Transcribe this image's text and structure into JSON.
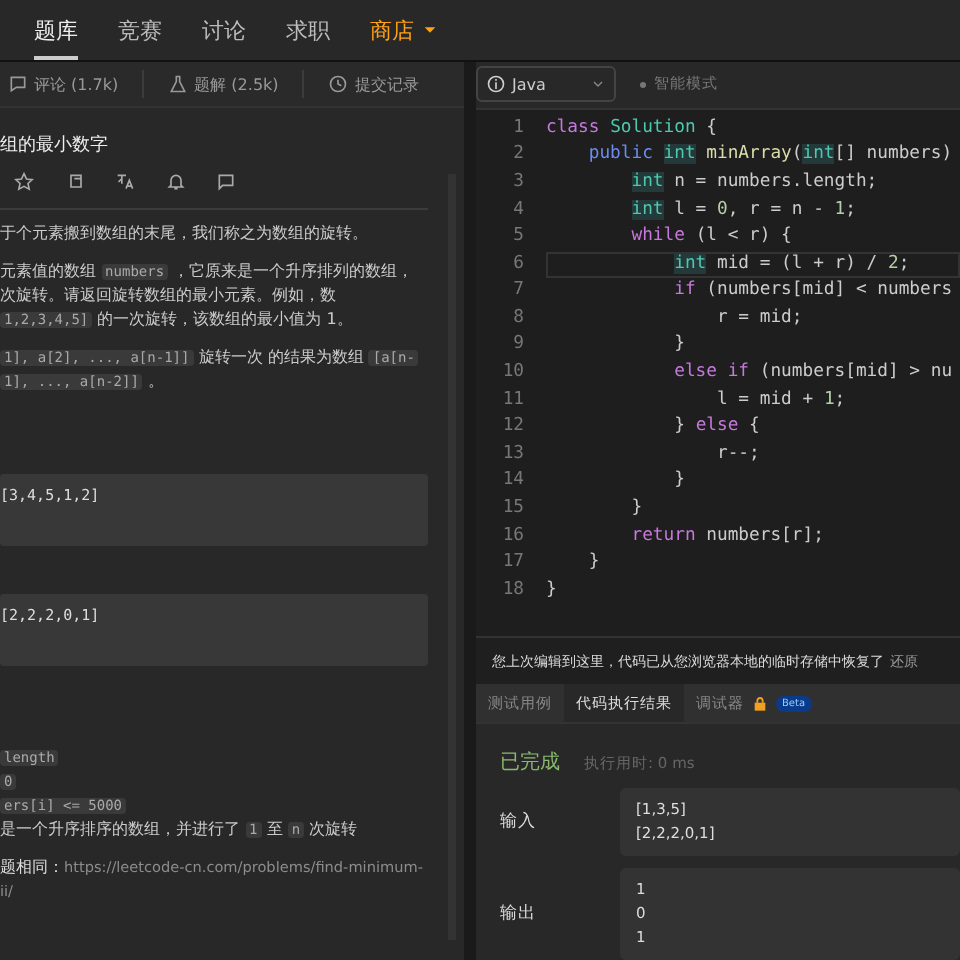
{
  "nav": [
    {
      "label": "题库",
      "selected": true,
      "kind": "plain"
    },
    {
      "label": "竞赛",
      "selected": false,
      "kind": "plain"
    },
    {
      "label": "讨论",
      "selected": false,
      "kind": "plain"
    },
    {
      "label": "求职",
      "selected": false,
      "kind": "plain"
    },
    {
      "label": "商店",
      "selected": false,
      "kind": "store"
    }
  ],
  "left_tabs": [
    {
      "label": "评论 (1.7k)"
    },
    {
      "label": "题解 (2.5k)"
    },
    {
      "label": "提交记录"
    }
  ],
  "problem": {
    "title": "组的最小数字",
    "paragraphs": [
      {
        "kind": "text",
        "lines": [
          [
            {
              "kind": "text",
              "text": "于个元素搬到数组的末尾，我们称之为数组的旋转。"
            }
          ]
        ]
      },
      {
        "kind": "text",
        "lines": [
          [
            {
              "kind": "text",
              "text": "元素值的数组 "
            },
            {
              "kind": "code",
              "text": "numbers"
            },
            {
              "kind": "text",
              "text": " ，它原来是一个升序排列的数组，"
            }
          ],
          [
            {
              "kind": "text",
              "text": "次旋转。请返回旋转数组的最小元素。例如，数"
            }
          ],
          [
            {
              "kind": "code",
              "text": "1,2,3,4,5]"
            },
            {
              "kind": "text",
              "text": " 的一次旋转，该数组的最小值为 1。"
            }
          ]
        ]
      },
      {
        "kind": "text",
        "lines": [
          [
            {
              "kind": "code",
              "text": "1], a[2], ..., a[n-1]]"
            },
            {
              "kind": "text",
              "text": " 旋转一次 的结果为数组 "
            },
            {
              "kind": "code",
              "text": "[a[n-"
            }
          ],
          [
            {
              "kind": "code",
              "text": "1], ..., a[n-2]]"
            },
            {
              "kind": "text",
              "text": " 。"
            }
          ]
        ]
      },
      {
        "kind": "example",
        "lines": [
          "[3,4,5,1,2]"
        ]
      },
      {
        "kind": "example",
        "lines": [
          "[2,2,2,0,1]"
        ]
      },
      {
        "kind": "text",
        "lines": [
          [
            {
              "kind": "code",
              "text": "length"
            }
          ],
          [
            {
              "kind": "code",
              "text": "0"
            }
          ],
          [
            {
              "kind": "code",
              "text": "ers[i] <= 5000"
            }
          ],
          [
            {
              "kind": "text",
              "text": "是一个升序排序的数组，并进行了 "
            },
            {
              "kind": "code",
              "text": "1"
            },
            {
              "kind": "text",
              "text": " 至 "
            },
            {
              "kind": "code",
              "text": "n"
            },
            {
              "kind": "text",
              "text": " 次旋转"
            }
          ]
        ]
      },
      {
        "kind": "link",
        "label": "题相同：",
        "lines": [
          "https://leetcode-cn.com/problems/find-minimum-",
          "ii/"
        ]
      }
    ]
  },
  "editor": {
    "language": "Java",
    "mode": "智能模式",
    "lines": [
      {
        "number": "1",
        "active": false,
        "tokens": [
          {
            "kind": "kw",
            "text": "class "
          },
          {
            "kind": "cls",
            "text": "Solution"
          },
          {
            "kind": "plain",
            "text": " {"
          }
        ]
      },
      {
        "number": "2",
        "active": false,
        "tokens": [
          {
            "kind": "kw2",
            "text": "    public "
          },
          {
            "kind": "type",
            "text": "int"
          },
          {
            "kind": "fn",
            "text": " minArray"
          },
          {
            "kind": "plain",
            "text": "("
          },
          {
            "kind": "type",
            "text": "int"
          },
          {
            "kind": "plain",
            "text": "[] numbers)"
          }
        ]
      },
      {
        "number": "3",
        "active": false,
        "tokens": [
          {
            "kind": "type",
            "text": "        int"
          },
          {
            "kind": "plain",
            "text": " n = numbers.length;"
          }
        ]
      },
      {
        "number": "4",
        "active": false,
        "tokens": [
          {
            "kind": "type",
            "text": "        int"
          },
          {
            "kind": "plain",
            "text": " l = "
          },
          {
            "kind": "num",
            "text": "0"
          },
          {
            "kind": "plain",
            "text": ", r = n - "
          },
          {
            "kind": "num",
            "text": "1"
          },
          {
            "kind": "plain",
            "text": ";"
          }
        ]
      },
      {
        "number": "5",
        "active": false,
        "tokens": [
          {
            "kind": "kw",
            "text": "        while"
          },
          {
            "kind": "plain",
            "text": " (l < r) {"
          }
        ]
      },
      {
        "number": "6",
        "active": true,
        "tokens": [
          {
            "kind": "type",
            "text": "            int"
          },
          {
            "kind": "plain",
            "text": " mid = (l + r) / "
          },
          {
            "kind": "num",
            "text": "2"
          },
          {
            "kind": "plain",
            "text": ";"
          }
        ]
      },
      {
        "number": "7",
        "active": false,
        "tokens": [
          {
            "kind": "kw",
            "text": "            if"
          },
          {
            "kind": "plain",
            "text": " (numbers[mid] < numbers"
          }
        ]
      },
      {
        "number": "8",
        "active": false,
        "tokens": [
          {
            "kind": "plain",
            "text": "                r = mid;"
          }
        ]
      },
      {
        "number": "9",
        "active": false,
        "tokens": [
          {
            "kind": "plain",
            "text": "            }"
          }
        ]
      },
      {
        "number": "10",
        "active": false,
        "tokens": [
          {
            "kind": "kw",
            "text": "            else if"
          },
          {
            "kind": "plain",
            "text": " (numbers[mid] > nu"
          }
        ]
      },
      {
        "number": "11",
        "active": false,
        "tokens": [
          {
            "kind": "plain",
            "text": "                l = mid + "
          },
          {
            "kind": "num",
            "text": "1"
          },
          {
            "kind": "plain",
            "text": ";"
          }
        ]
      },
      {
        "number": "12",
        "active": false,
        "tokens": [
          {
            "kind": "plain",
            "text": "            } "
          },
          {
            "kind": "kw",
            "text": "else"
          },
          {
            "kind": "plain",
            "text": " {"
          }
        ]
      },
      {
        "number": "13",
        "active": false,
        "tokens": [
          {
            "kind": "plain",
            "text": "                r--;"
          }
        ]
      },
      {
        "number": "14",
        "active": false,
        "tokens": [
          {
            "kind": "plain",
            "text": "            }"
          }
        ]
      },
      {
        "number": "15",
        "active": false,
        "tokens": [
          {
            "kind": "plain",
            "text": "        }"
          }
        ]
      },
      {
        "number": "16",
        "active": false,
        "tokens": [
          {
            "kind": "kw",
            "text": "        return"
          },
          {
            "kind": "plain",
            "text": " numbers[r];"
          }
        ]
      },
      {
        "number": "17",
        "active": false,
        "tokens": [
          {
            "kind": "plain",
            "text": "    }"
          }
        ]
      },
      {
        "number": "18",
        "active": false,
        "tokens": [
          {
            "kind": "plain",
            "text": "}"
          }
        ]
      }
    ]
  },
  "notice": {
    "text": "您上次编辑到这里，代码已从您浏览器本地的临时存储中恢复了",
    "link": "还原"
  },
  "bottom_tabs": [
    {
      "label": "测试用例",
      "selected": false,
      "locked": false
    },
    {
      "label": "代码执行结果",
      "selected": true,
      "locked": false
    },
    {
      "label": "调试器",
      "selected": false,
      "locked": true,
      "badge": "Beta"
    }
  ],
  "result": {
    "status": "已完成",
    "time": "执行用时: 0 ms",
    "rows": [
      {
        "label": "输入",
        "lines": [
          "[1,3,5]",
          "[2,2,2,0,1]"
        ]
      },
      {
        "label": "输出",
        "lines": [
          "1",
          "0",
          "1"
        ]
      }
    ]
  }
}
